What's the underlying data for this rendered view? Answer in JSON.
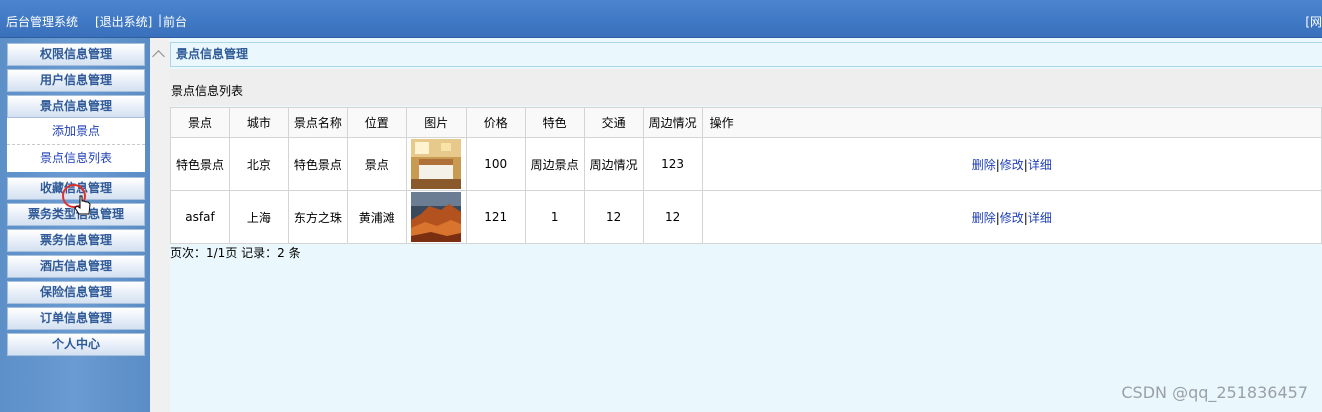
{
  "header": {
    "system_name": "后台管理系统",
    "logout_label": "[退出系统]",
    "separator": "|",
    "frontend_label": "前台",
    "right_text": "[网"
  },
  "sidebar": {
    "items": [
      {
        "label": "权限信息管理"
      },
      {
        "label": "用户信息管理"
      },
      {
        "label": "景点信息管理"
      },
      {
        "label": "收藏信息管理"
      },
      {
        "label": "票务类型信息管理"
      },
      {
        "label": "票务信息管理"
      },
      {
        "label": "酒店信息管理"
      },
      {
        "label": "保险信息管理"
      },
      {
        "label": "订单信息管理"
      },
      {
        "label": "个人中心"
      }
    ],
    "subitems": [
      {
        "label": "添加景点"
      },
      {
        "label": "景点信息列表"
      }
    ]
  },
  "main": {
    "breadcrumb": "景点信息管理",
    "list_title": "景点信息列表",
    "columns": [
      "景点",
      "城市",
      "景点名称",
      "位置",
      "图片",
      "价格",
      "特色",
      "交通",
      "周边情况",
      "操作"
    ],
    "rows": [
      {
        "spot": "特色景点",
        "city": "北京",
        "name": "特色景点",
        "location": "景点",
        "image": "hotel-room-thumbnail",
        "price": "100",
        "feature": "周边景点",
        "traffic": "周边情况",
        "surroundings": "123"
      },
      {
        "spot": "asfaf",
        "city": "上海",
        "name": "东方之珠",
        "location": "黄浦滩",
        "image": "red-rock-canyon-thumbnail",
        "price": "121",
        "feature": "1",
        "traffic": "12",
        "surroundings": "12"
      }
    ],
    "actions": {
      "delete": "删除",
      "edit": "修改",
      "detail": "详细",
      "sep": "|"
    },
    "pager": "页次：1/1页 记录：2 条"
  },
  "watermark": "CSDN @qq_251836457",
  "colors": {
    "header": "#4d85cf",
    "sidebar": "#6a9bd2",
    "link": "#1f3fb8",
    "content_bg": "#eaf8fd"
  }
}
